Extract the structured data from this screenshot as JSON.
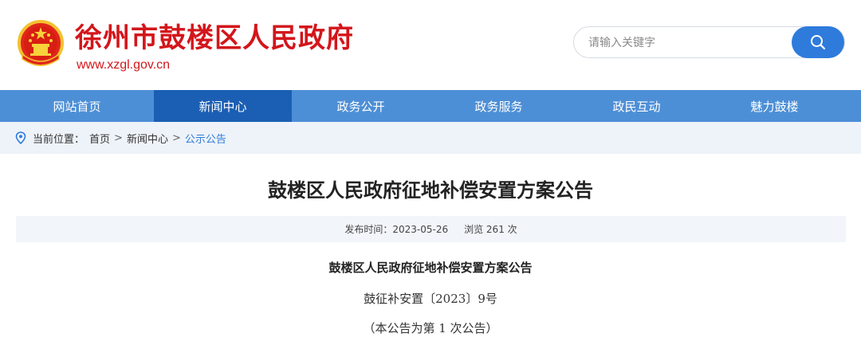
{
  "header": {
    "site_title": "徐州市鼓楼区人民政府",
    "site_url": "www.xzgl.gov.cn",
    "emblem_icon": "national-emblem-icon",
    "brand_color": "#d3161b"
  },
  "search": {
    "placeholder": "请输入关键字",
    "button_icon": "search-icon",
    "button_color": "#2e7bdc"
  },
  "nav": {
    "items": [
      {
        "label": "网站首页"
      },
      {
        "label": "新闻中心"
      },
      {
        "label": "政务公开"
      },
      {
        "label": "政务服务"
      },
      {
        "label": "政民互动"
      },
      {
        "label": "魅力鼓楼"
      }
    ],
    "active_label": "新闻中心",
    "bar_color": "#4d8fd6",
    "active_color": "#1b5fb4"
  },
  "breadcrumb": {
    "prefix": "当前位置：",
    "items": [
      "首页",
      "新闻中心",
      "公示公告"
    ],
    "separator": ">",
    "icon": "location-pin-icon"
  },
  "article": {
    "title": "鼓楼区人民政府征地补偿安置方案公告",
    "publish_label": "发布时间：",
    "publish_date": "2023-05-26",
    "views_text": "浏览 261 次",
    "body": {
      "heading": "鼓楼区人民政府征地补偿安置方案公告",
      "doc_number": "鼓征补安置〔2023〕9号",
      "notice_count": "（本公告为第 1 次公告）"
    }
  }
}
